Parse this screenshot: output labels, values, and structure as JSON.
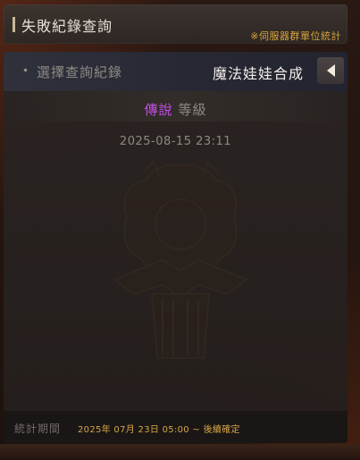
{
  "header": {
    "title": "失敗紀錄查詢",
    "note": "※伺服器群單位統計"
  },
  "selector": {
    "label": "選擇查詢紀錄",
    "value": "魔法娃娃合成"
  },
  "record": {
    "grade_name": "傳說",
    "grade_suffix": "等級",
    "timestamp": "2025-08-15 23:11"
  },
  "footer": {
    "label": "統計期間",
    "value": "2025年 07月 23日 05:00 ~ 後續確定"
  },
  "colors": {
    "grade": "#c34fe3",
    "note": "#d8a63c",
    "footer_value": "#d7a547"
  },
  "icons": {
    "selector_bullet": "diamond-bullet-icon",
    "selector_arrow": "arrow-left-icon",
    "emblem": "lion-crest-emblem"
  }
}
